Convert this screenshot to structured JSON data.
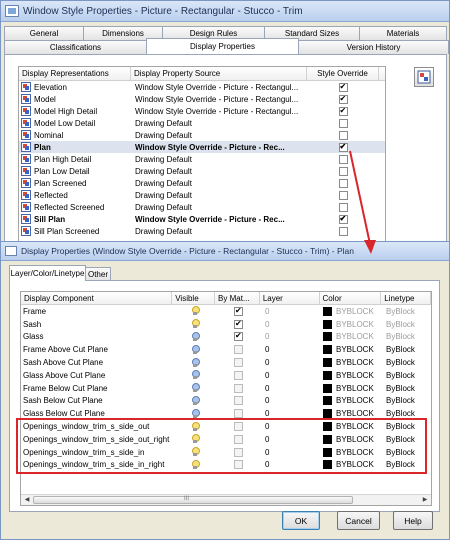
{
  "outer": {
    "title": "Window Style Properties - Picture - Rectangular - Stucco - Trim",
    "tabs_back": [
      "General",
      "Dimensions",
      "Design Rules",
      "Standard Sizes",
      "Materials"
    ],
    "tabs_front": [
      "Classifications",
      "Display Properties",
      "Version History"
    ],
    "active_tab": "Display Properties",
    "columns": [
      "Display Representations",
      "Display Property Source",
      "Style Override"
    ],
    "rows": [
      {
        "name": "Elevation",
        "source": "Window Style Override - Picture - Rectangul...",
        "override": true,
        "bold": false
      },
      {
        "name": "Model",
        "source": "Window Style Override - Picture - Rectangul...",
        "override": true,
        "bold": false
      },
      {
        "name": "Model High Detail",
        "source": "Window Style Override - Picture - Rectangul...",
        "override": true,
        "bold": false
      },
      {
        "name": "Model Low Detail",
        "source": "Drawing Default",
        "override": false,
        "bold": false
      },
      {
        "name": "Nominal",
        "source": "Drawing Default",
        "override": false,
        "bold": false
      },
      {
        "name": "Plan",
        "source": "Window Style Override - Picture - Rec...",
        "override": true,
        "bold": true
      },
      {
        "name": "Plan High Detail",
        "source": "Drawing Default",
        "override": false,
        "bold": false
      },
      {
        "name": "Plan Low Detail",
        "source": "Drawing Default",
        "override": false,
        "bold": false
      },
      {
        "name": "Plan Screened",
        "source": "Drawing Default",
        "override": false,
        "bold": false
      },
      {
        "name": "Reflected",
        "source": "Drawing Default",
        "override": false,
        "bold": false
      },
      {
        "name": "Reflected Screened",
        "source": "Drawing Default",
        "override": false,
        "bold": false
      },
      {
        "name": "Sill Plan",
        "source": "Window Style Override - Picture - Rec...",
        "override": true,
        "bold": true
      },
      {
        "name": "Sill Plan Screened",
        "source": "Drawing Default",
        "override": false,
        "bold": false
      }
    ]
  },
  "inner": {
    "title": "Display Properties (Window Style Override - Picture - Rectangular - Stucco - Trim) - Plan",
    "tabs": [
      "Layer/Color/Linetype",
      "Other"
    ],
    "active_tab": "Layer/Color/Linetype",
    "columns": [
      "Display Component",
      "Visible",
      "By Mat...",
      "Layer",
      "Color",
      "Linetype"
    ],
    "rows": [
      {
        "component": "Frame",
        "visible": "on",
        "bymat": true,
        "bymat_enabled": true,
        "layer": "0",
        "color": "BYBLOCK",
        "linetype": "ByBlock",
        "dim": true
      },
      {
        "component": "Sash",
        "visible": "on",
        "bymat": true,
        "bymat_enabled": true,
        "layer": "0",
        "color": "BYBLOCK",
        "linetype": "ByBlock",
        "dim": true
      },
      {
        "component": "Glass",
        "visible": "off",
        "bymat": true,
        "bymat_enabled": true,
        "layer": "0",
        "color": "BYBLOCK",
        "linetype": "ByBlock",
        "dim": true
      },
      {
        "component": "Frame Above Cut Plane",
        "visible": "off",
        "bymat": false,
        "bymat_enabled": false,
        "layer": "0",
        "color": "BYBLOCK",
        "linetype": "ByBlock",
        "dim": false
      },
      {
        "component": "Sash Above Cut Plane",
        "visible": "off",
        "bymat": false,
        "bymat_enabled": false,
        "layer": "0",
        "color": "BYBLOCK",
        "linetype": "ByBlock",
        "dim": false
      },
      {
        "component": "Glass Above Cut Plane",
        "visible": "off",
        "bymat": false,
        "bymat_enabled": false,
        "layer": "0",
        "color": "BYBLOCK",
        "linetype": "ByBlock",
        "dim": false
      },
      {
        "component": "Frame Below Cut Plane",
        "visible": "off",
        "bymat": false,
        "bymat_enabled": false,
        "layer": "0",
        "color": "BYBLOCK",
        "linetype": "ByBlock",
        "dim": false
      },
      {
        "component": "Sash Below Cut Plane",
        "visible": "off",
        "bymat": false,
        "bymat_enabled": false,
        "layer": "0",
        "color": "BYBLOCK",
        "linetype": "ByBlock",
        "dim": false
      },
      {
        "component": "Glass Below Cut Plane",
        "visible": "off",
        "bymat": false,
        "bymat_enabled": false,
        "layer": "0",
        "color": "BYBLOCK",
        "linetype": "ByBlock",
        "dim": false
      },
      {
        "component": "Openings_window_trim_s_side_out",
        "visible": "on",
        "bymat": false,
        "bymat_enabled": false,
        "layer": "0",
        "color": "BYBLOCK",
        "linetype": "ByBlock",
        "dim": false
      },
      {
        "component": "Openings_window_trim_s_side_out_right",
        "visible": "on",
        "bymat": false,
        "bymat_enabled": false,
        "layer": "0",
        "color": "BYBLOCK",
        "linetype": "ByBlock",
        "dim": false
      },
      {
        "component": "Openings_window_trim_s_side_in",
        "visible": "on",
        "bymat": false,
        "bymat_enabled": false,
        "layer": "0",
        "color": "BYBLOCK",
        "linetype": "ByBlock",
        "dim": false
      },
      {
        "component": "Openings_window_trim_s_side_in_right",
        "visible": "on",
        "bymat": false,
        "bymat_enabled": false,
        "layer": "0",
        "color": "BYBLOCK",
        "linetype": "ByBlock",
        "dim": false
      }
    ],
    "scroll_grip": "III",
    "buttons": {
      "ok": "OK",
      "cancel": "Cancel",
      "help": "Help"
    }
  },
  "colors": {
    "highlight": "#d8262b",
    "title_text": "#1b2f55"
  }
}
